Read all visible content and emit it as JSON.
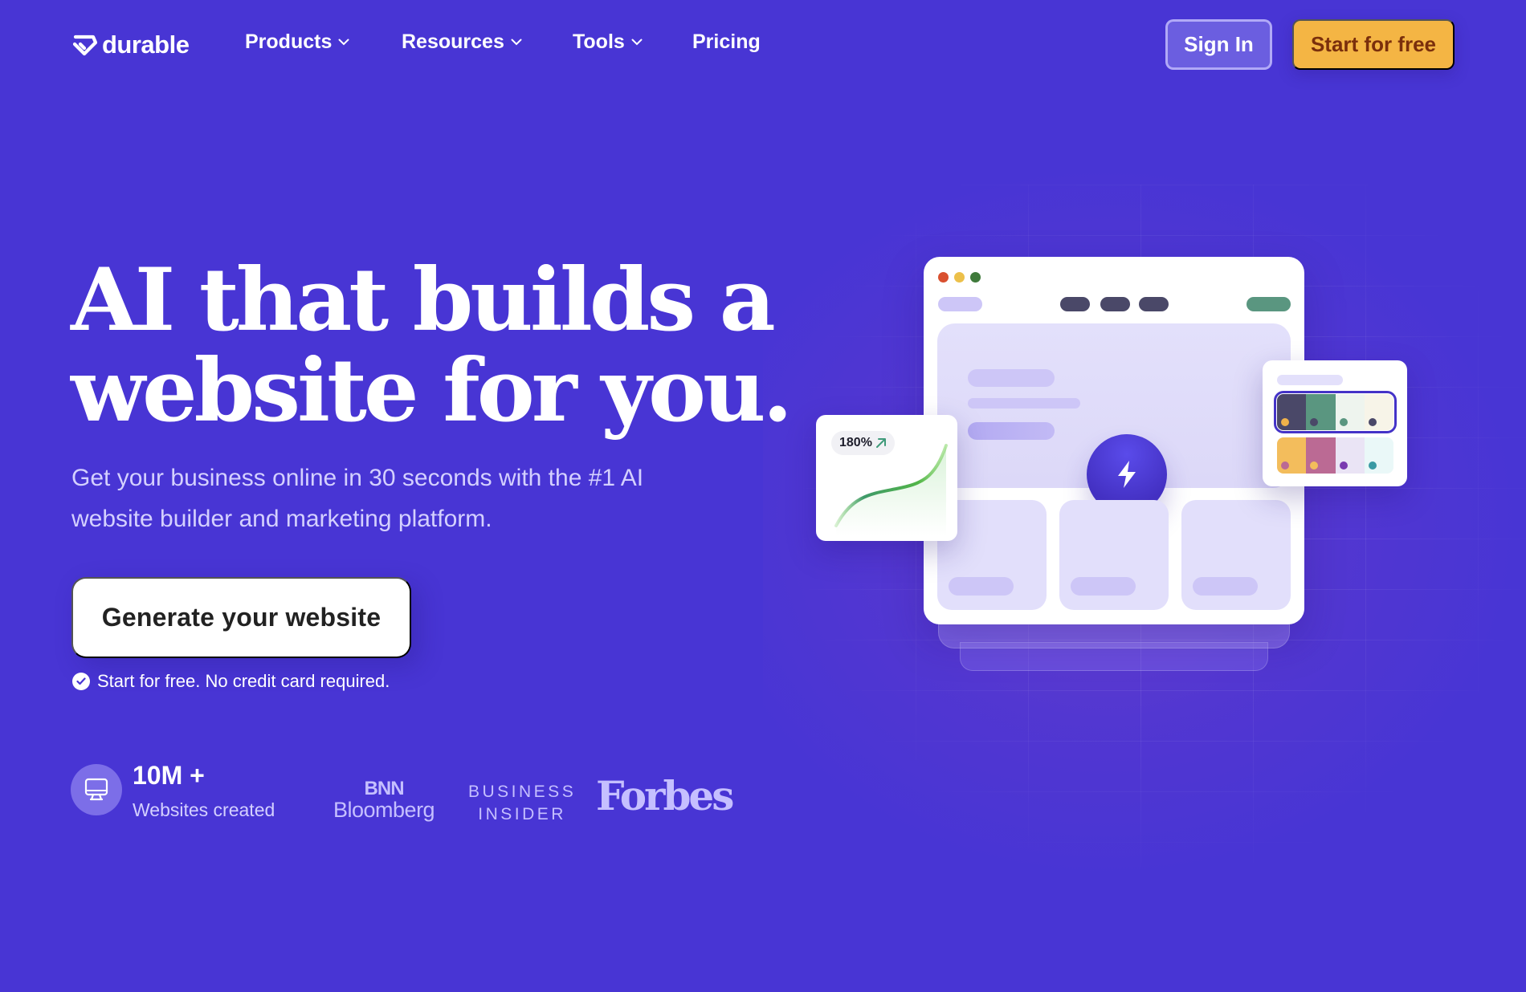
{
  "brand": {
    "name": "durable",
    "logo_icon": "diamond-logo-icon"
  },
  "nav": {
    "items": [
      {
        "label": "Products",
        "has_dropdown": true
      },
      {
        "label": "Resources",
        "has_dropdown": true
      },
      {
        "label": "Tools",
        "has_dropdown": true
      },
      {
        "label": "Pricing",
        "has_dropdown": false
      }
    ],
    "sign_in_label": "Sign In",
    "start_label": "Start for free"
  },
  "hero": {
    "headline_line1": "AI that builds a",
    "headline_line2": "website for you.",
    "subtitle": "Get your business online in 30 seconds with the #1 AI website builder and marketing platform.",
    "cta_label": "Generate your website",
    "cta_note": "Start for free. No credit card required."
  },
  "stats": {
    "value": "10M +",
    "label": "Websites created",
    "icon": "monitor-icon"
  },
  "press": {
    "bnn_line1": "BNN",
    "bnn_line2": "Bloomberg",
    "bi_line1": "BUSINESS",
    "bi_line2": "INSIDER",
    "forbes": "Forbes"
  },
  "illustration": {
    "growth_badge": "180%",
    "window_dots": [
      "#d9502f",
      "#ecc04a",
      "#3f7a3b"
    ],
    "palettes": [
      {
        "selected": true,
        "swatches": [
          "#4a4868",
          "#5a9680",
          "#eef4ee",
          "#f7f4e8"
        ],
        "dots": [
          "#f0b24a",
          "#4a4868",
          "#5a9680",
          "#4a4868"
        ]
      },
      {
        "selected": false,
        "swatches": [
          "#f3bd5c",
          "#bb6a94",
          "#eae4f5",
          "#eaf8f8"
        ],
        "dots": [
          "#bb6a94",
          "#f3bd5c",
          "#7a3ab0",
          "#3a9aa4"
        ]
      }
    ],
    "colors": {
      "nav_pill_dark": "#4a4868",
      "nav_pill_green": "#5a9680",
      "accent": "#4433c7"
    }
  },
  "colors": {
    "background": "#4835d4",
    "start_button": "#f4b544",
    "start_button_text": "#7a2f0c"
  }
}
